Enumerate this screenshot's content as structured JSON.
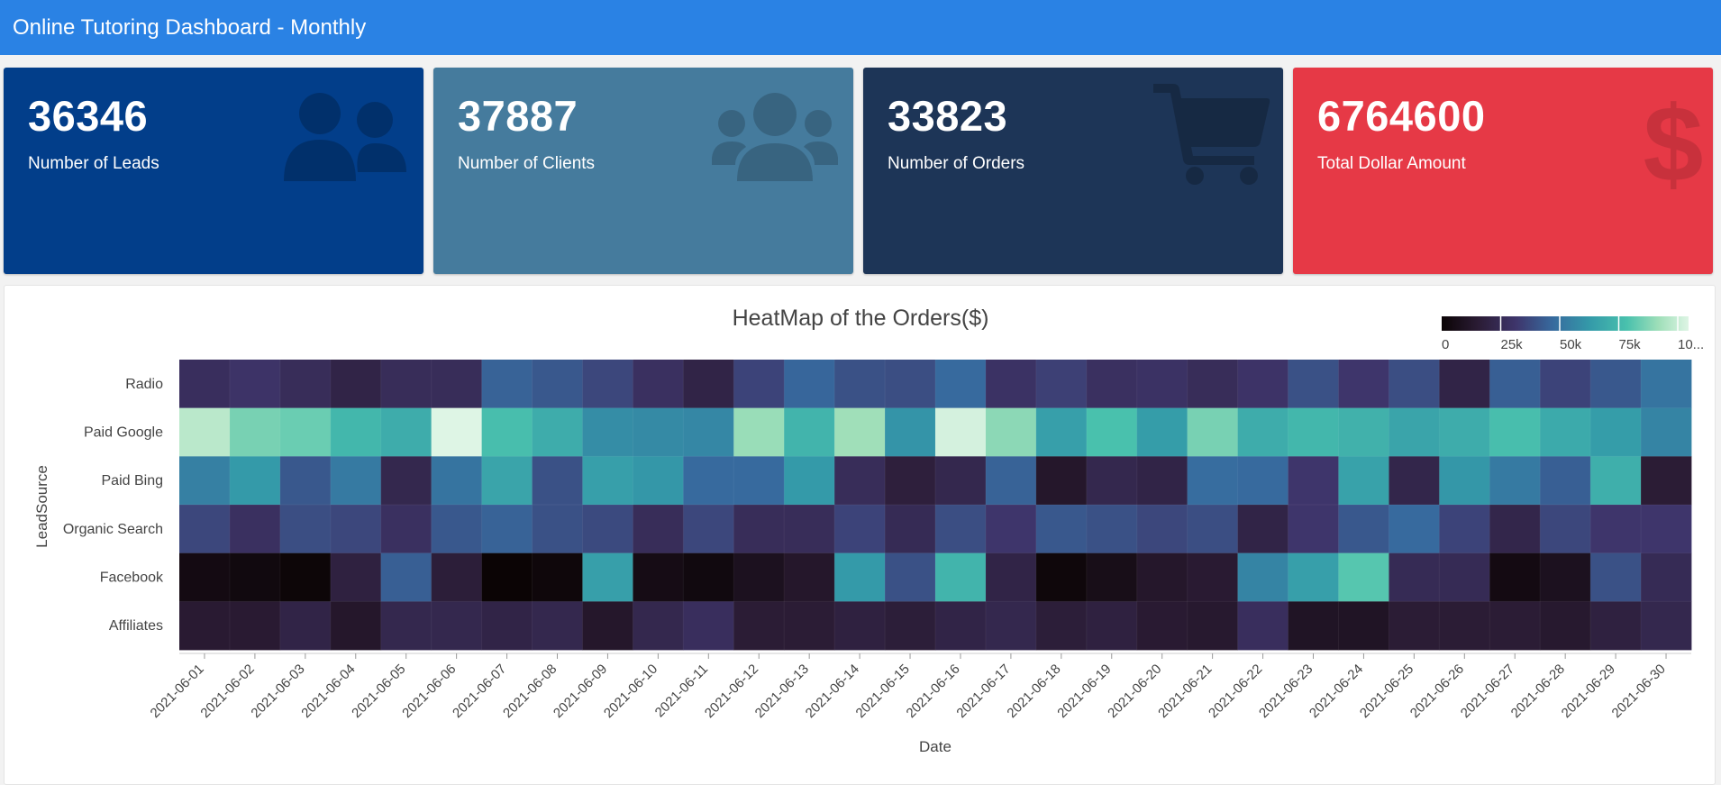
{
  "header": {
    "title": "Online Tutoring Dashboard - Monthly"
  },
  "cards": [
    {
      "value": "36346",
      "label": "Number of Leads",
      "bg": "#023e8a",
      "icon": "users-icon"
    },
    {
      "value": "37887",
      "label": "Number of Clients",
      "bg": "#457b9d",
      "icon": "user-group-icon"
    },
    {
      "value": "33823",
      "label": "Number of Orders",
      "bg": "#1d3557",
      "icon": "shopping-cart-icon"
    },
    {
      "value": "6764600",
      "label": "Total Dollar Amount",
      "bg": "#e63946",
      "icon": "dollar-icon"
    }
  ],
  "chart_data": {
    "type": "heatmap",
    "title": "HeatMap of the Orders($)",
    "xlabel": "Date",
    "ylabel": "LeadSource",
    "x": [
      "2021-06-01",
      "2021-06-02",
      "2021-06-03",
      "2021-06-04",
      "2021-06-05",
      "2021-06-06",
      "2021-06-07",
      "2021-06-08",
      "2021-06-09",
      "2021-06-10",
      "2021-06-11",
      "2021-06-12",
      "2021-06-13",
      "2021-06-14",
      "2021-06-15",
      "2021-06-16",
      "2021-06-17",
      "2021-06-18",
      "2021-06-19",
      "2021-06-20",
      "2021-06-21",
      "2021-06-22",
      "2021-06-23",
      "2021-06-24",
      "2021-06-25",
      "2021-06-26",
      "2021-06-27",
      "2021-06-28",
      "2021-06-29",
      "2021-06-30"
    ],
    "y": [
      "Radio",
      "Paid Google",
      "Paid Bing",
      "Organic Search",
      "Facebook",
      "Affiliates"
    ],
    "z": [
      [
        26000,
        29000,
        25000,
        20000,
        25000,
        25000,
        43000,
        40000,
        35000,
        27000,
        20000,
        34000,
        44000,
        38000,
        37000,
        45000,
        28000,
        33000,
        27000,
        28000,
        25000,
        29000,
        38000,
        30000,
        37000,
        20000,
        42000,
        34000,
        40000,
        48000
      ],
      [
        93000,
        82000,
        80000,
        71000,
        67000,
        100000,
        74000,
        67000,
        56000,
        55000,
        54000,
        87000,
        70000,
        88000,
        58000,
        98000,
        85000,
        62000,
        75000,
        61000,
        82000,
        67000,
        71000,
        69000,
        64000,
        67000,
        74000,
        66000,
        61000,
        53000
      ],
      [
        52000,
        60000,
        40000,
        50000,
        22000,
        48000,
        64000,
        38000,
        62000,
        59000,
        45000,
        45000,
        60000,
        25000,
        17000,
        22000,
        43000,
        12000,
        22000,
        20000,
        46000,
        45000,
        30000,
        63000,
        21000,
        59000,
        50000,
        42000,
        68000,
        15000
      ],
      [
        35000,
        27000,
        37000,
        35000,
        27000,
        40000,
        43000,
        38000,
        36000,
        25000,
        35000,
        25000,
        25000,
        34000,
        24000,
        37000,
        30000,
        40000,
        38000,
        35000,
        37000,
        20000,
        30000,
        40000,
        45000,
        34000,
        21000,
        35000,
        30000,
        30000
      ],
      [
        4000,
        3000,
        1000,
        18000,
        42000,
        16000,
        0,
        2000,
        62000,
        5000,
        3000,
        8000,
        12000,
        60000,
        38000,
        70000,
        20000,
        2000,
        6000,
        12000,
        14000,
        53000,
        62000,
        77000,
        24000,
        24000,
        4000,
        8000,
        38000,
        24000
      ],
      [
        14000,
        14000,
        20000,
        12000,
        22000,
        22000,
        20000,
        22000,
        12000,
        22000,
        26000,
        15000,
        15000,
        18000,
        16000,
        20000,
        22000,
        16000,
        18000,
        14000,
        13000,
        26000,
        10000,
        10000,
        15000,
        15000,
        15000,
        13000,
        18000,
        22000
      ]
    ],
    "zmin": 0,
    "zmax": 100000,
    "colorscale": "mako",
    "colorbar_ticks": [
      "0",
      "25k",
      "50k",
      "75k",
      "10..."
    ],
    "colorbar_tick_values": [
      0,
      25000,
      50000,
      75000,
      100000
    ],
    "legend_placement": "top-right",
    "grid": false
  }
}
